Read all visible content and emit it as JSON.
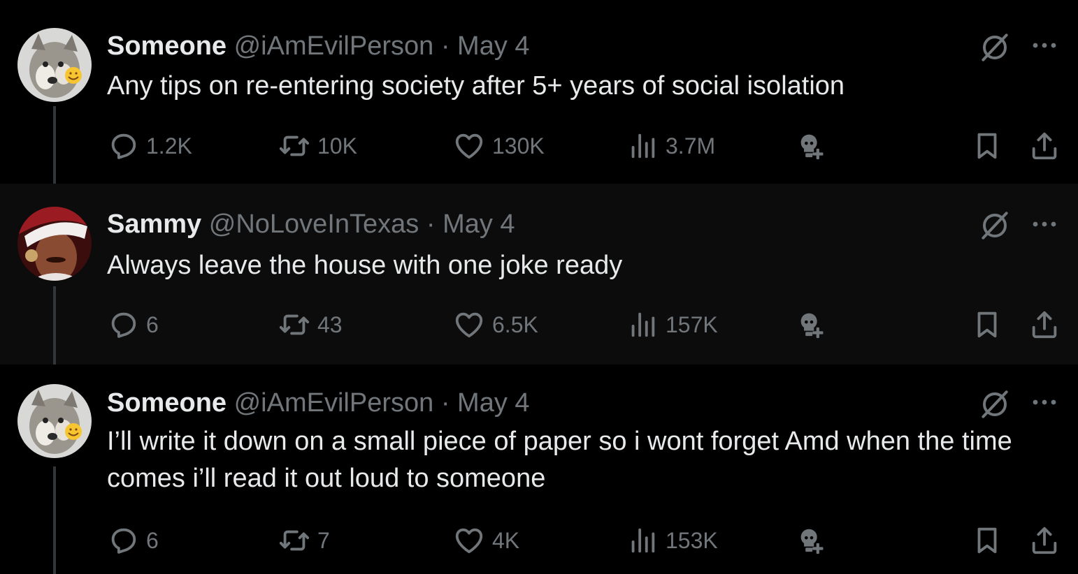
{
  "colors": {
    "background": "#000000",
    "highlight_background": "#0c0c0c",
    "primary_text": "#e7e9ea",
    "secondary_text": "#71767b",
    "thread_line": "#333639"
  },
  "tweets": [
    {
      "display_name": "Someone",
      "handle": "@iAmEvilPerson",
      "separator": "·",
      "date": "May 4",
      "text": "Any tips on re-entering society after 5+ years of social isolation",
      "avatar_icon": "puppy-avatar",
      "stats": {
        "replies": "1.2K",
        "retweets": "10K",
        "likes": "130K",
        "views": "3.7M"
      }
    },
    {
      "display_name": "Sammy",
      "handle": "@NoLoveInTexas",
      "separator": "·",
      "date": "May 4",
      "text": "Always leave the house with one joke ready",
      "avatar_icon": "santa-hat-avatar",
      "stats": {
        "replies": "6",
        "retweets": "43",
        "likes": "6.5K",
        "views": "157K"
      }
    },
    {
      "display_name": "Someone",
      "handle": "@iAmEvilPerson",
      "separator": "·",
      "date": "May 4",
      "text": "I’ll write it down on a small piece of paper so i wont forget Amd when the time comes i’ll read it out loud to someone",
      "avatar_icon": "puppy-avatar",
      "stats": {
        "replies": "6",
        "retweets": "7",
        "likes": "4K",
        "views": "153K"
      }
    }
  ]
}
